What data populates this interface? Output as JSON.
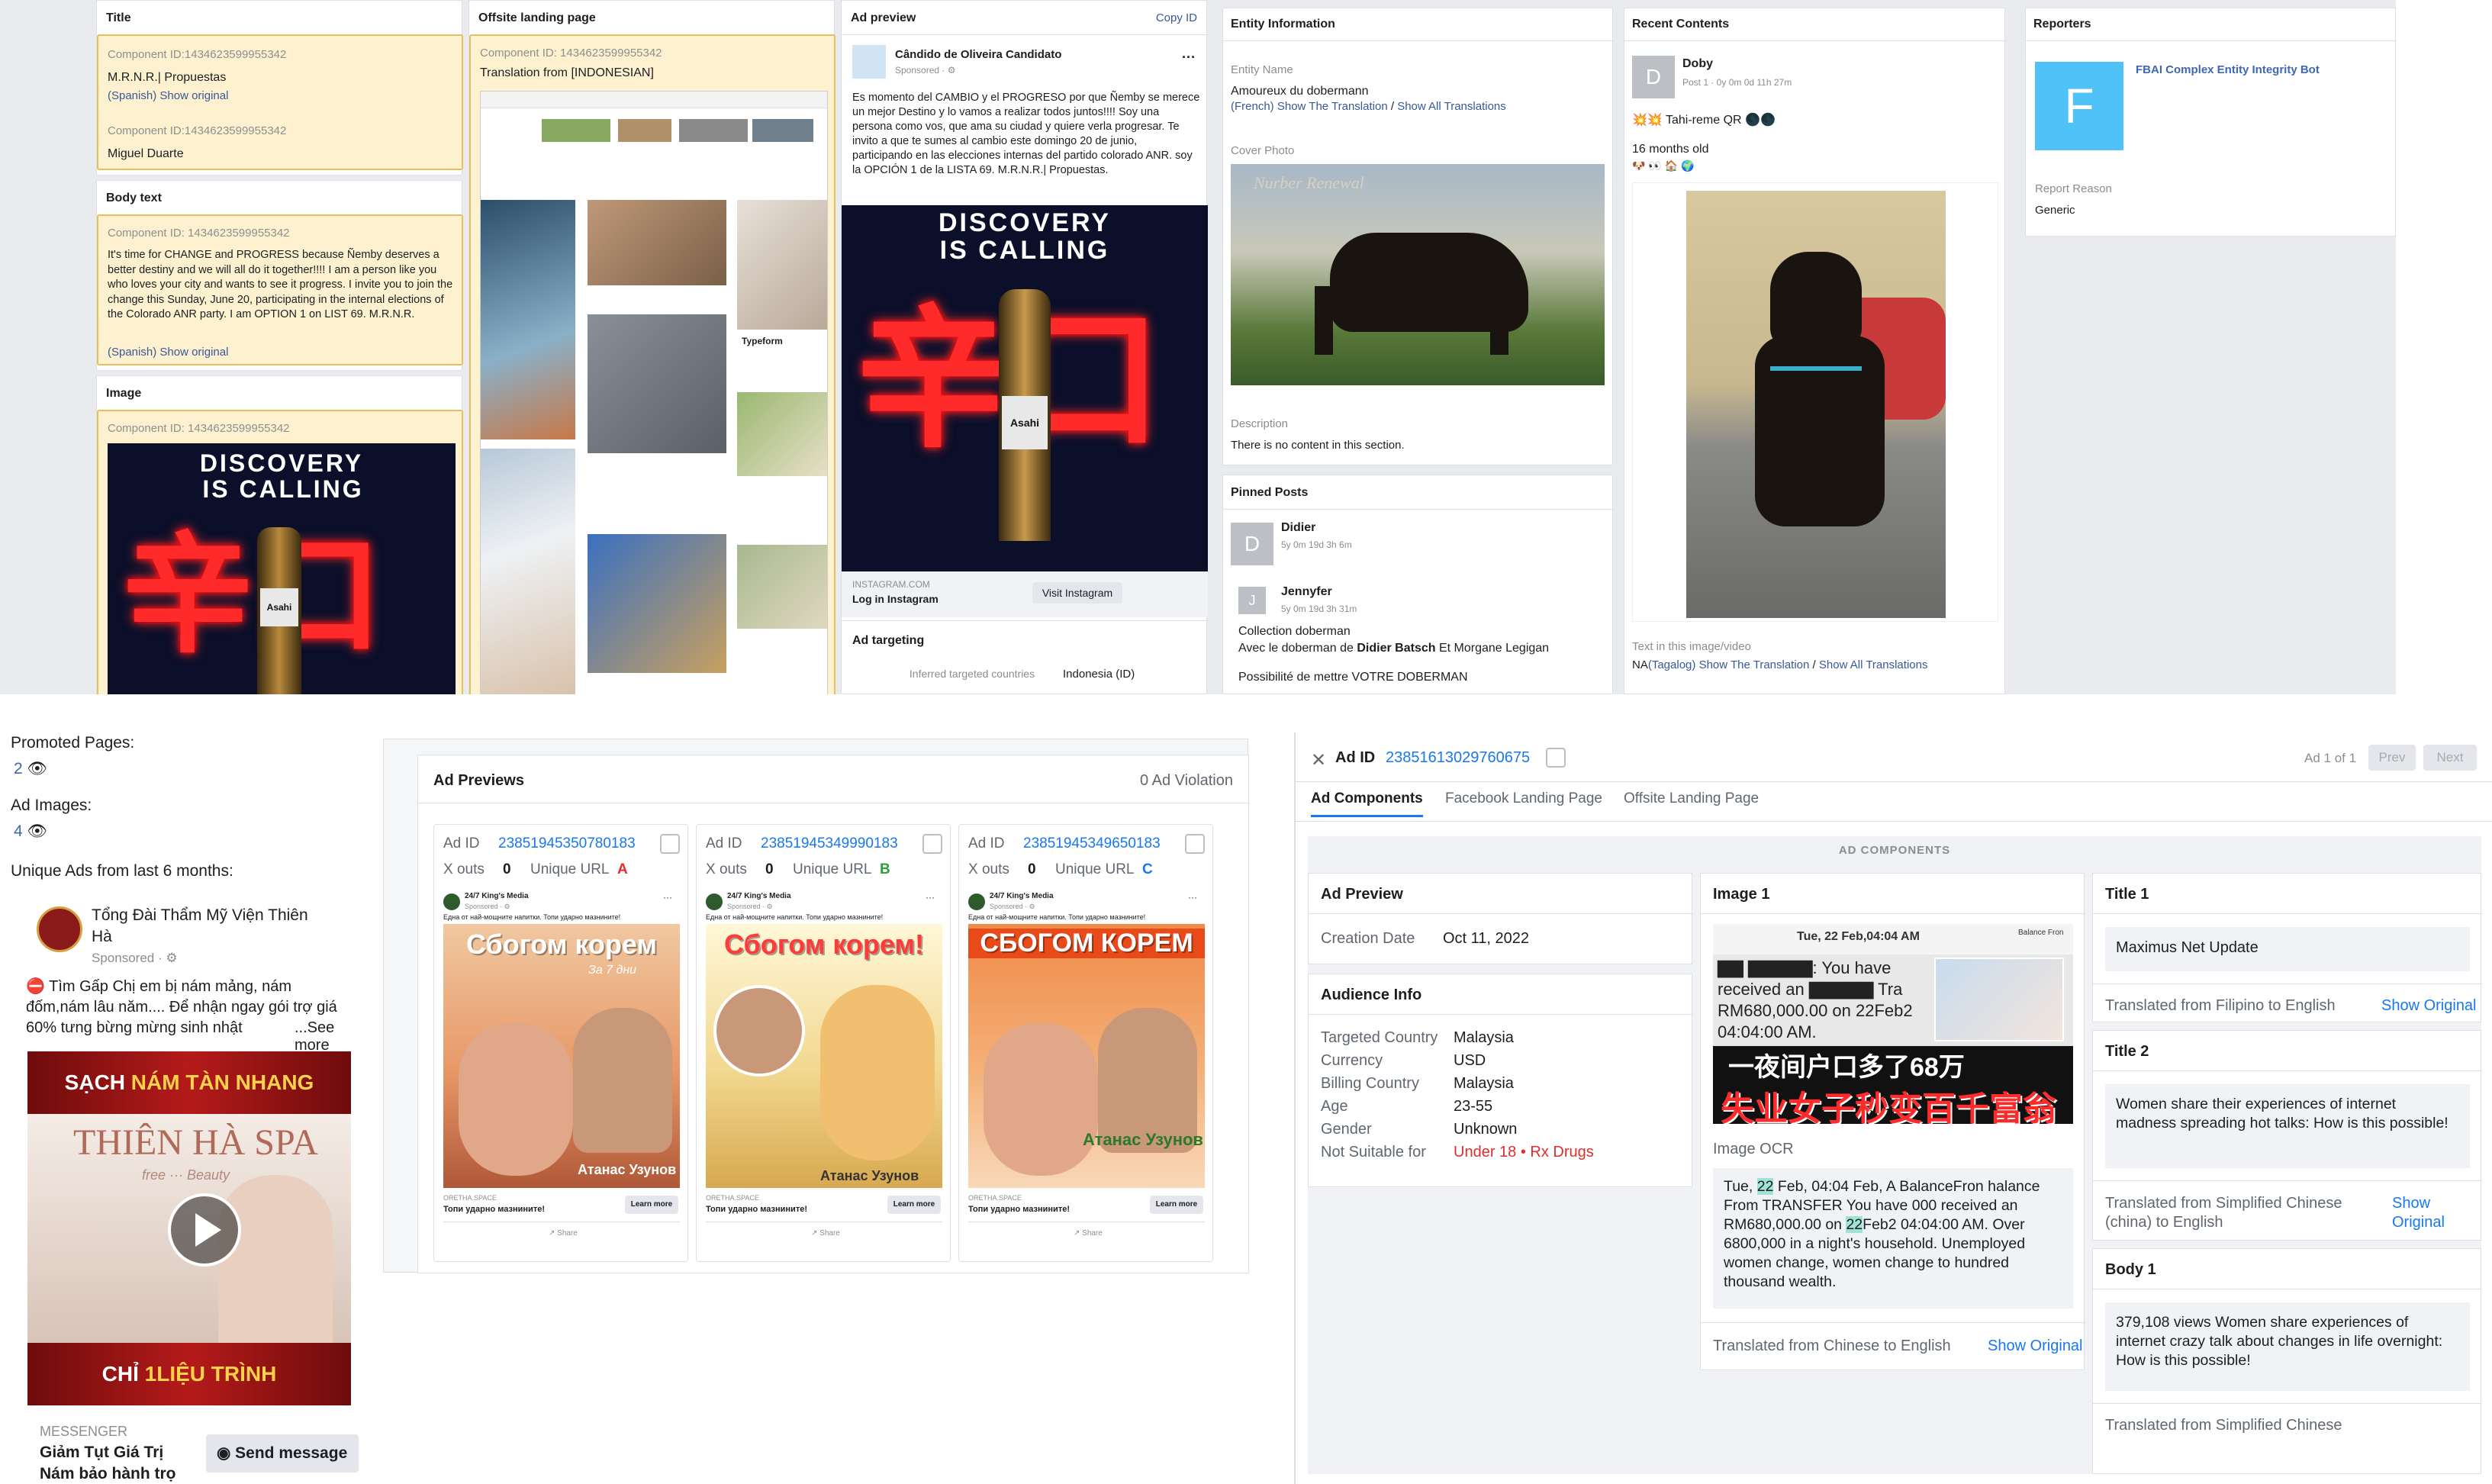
{
  "q1": {
    "title_label": "Title",
    "comp_id_1": "Component ID:1434623599955342",
    "title_value": "M.R.N.R.| Propuestas",
    "spanish_1": "(Spanish)",
    "show_original": "Show original",
    "comp_id_2": "Component ID:1434623599955342",
    "name_value": "Miguel Duarte",
    "body_label": "Body text",
    "comp_id_3": "Component ID: 1434623599955342",
    "body_value": "It's time for CHANGE and PROGRESS because Ñemby deserves a better destiny and we will all do it together!!!! I am a person like you who loves your city and wants to see it progress. I invite you to join the change this Sunday, June 20, participating in the internal elections of the Colorado ANR party. I am OPTION 1 on LIST 69. M.R.N.R.",
    "spanish_2": "(Spanish)",
    "image_label": "Image",
    "comp_id_4": "Component ID: 1434623599955342",
    "poster_text_1": "DISCOVERY",
    "poster_text_2": "IS CALLING",
    "neon_chars": "辛口",
    "landing_label": "Offsite landing page",
    "comp_id_5": "Component ID: 1434623599955342",
    "translation_from": "Translation from [INDONESIAN]",
    "typeform_label": "Typeform",
    "ad_preview_label": "Ad preview",
    "copy_id": "Copy ID",
    "advertiser": "Cândido de Oliveira Candidato",
    "sponsored": "Sponsored · ⚙",
    "ad_text": "Es momento del CAMBIO y el PROGRESO por que Ñemby se merece un mejor Destino y lo vamos a realizar todos juntos!!!! Soy una persona como vos, que ama su ciudad y quiere verla progresar. Te invito a que te sumes al cambio este domingo 20 de junio, participando en las elecciones internas del partido colorado ANR. soy la OPCIÓN 1 de la LISTA 69. M.R.N.R.| Propuestas.",
    "beer_brand": "Asahi",
    "insta_domain": "INSTAGRAM.COM",
    "insta_login": "Log in Instagram",
    "visit_instagram": "Visit Instagram",
    "ad_targeting": "Ad targeting",
    "inferred_targeted": "Inferred targeted countries",
    "targeted_country": "Indonesia (ID)",
    "entity_info": "Entity Information",
    "entity_name_label": "Entity Name",
    "entity_name": "Amoureux du dobermann",
    "french": "(French)",
    "show_translation": "Show The Translation",
    "slash": "/",
    "show_all_translations": "Show All Translations",
    "cover_photo": "Cover Photo",
    "cover_caption": "Nurber Renewal",
    "description_label": "Description",
    "description_value": "There is no content in this section.",
    "pinned_posts": "Pinned Posts",
    "didier": "Didier",
    "didier_time": "5y 0m 19d 3h 6m",
    "jennyfer": "Jennyfer",
    "jennyfer_time": "5y 0m 19d 3h 31m",
    "collection": "Collection doberman",
    "avec_prefix": "Avec le doberman de",
    "didier_batsch": "Didier Batsch",
    "avec_suffix": "Et Morgane Legigan",
    "possibilite": "Possibilité de mettre VOTRE DOBERMAN",
    "recent_contents": "Recent Contents",
    "doby": "Doby",
    "doby_meta": "Post 1 · 0y 0m 0d 11h 27m",
    "tahi_line": "💥💥 Tahi-reme QR 🌑🌑",
    "months_old": "16 months old",
    "emoji_line": "🐶 👀 🏠 🌍",
    "text_in_image": "Text in this image/video",
    "na": "NA",
    "tagalog": "(Tagalog)",
    "reporters": "Reporters",
    "reporter_initial": "F",
    "reporter_name": "FBAI Complex Entity Integrity Bot",
    "report_reason_label": "Report Reason",
    "report_reason": "Generic"
  },
  "q3": {
    "promoted_pages": "Promoted Pages:",
    "promoted_count": "2",
    "ad_images": "Ad Images:",
    "ad_images_count": "4",
    "unique_ads": "Unique Ads from last 6 months:",
    "page_name": "Tổng Đài Thẩm Mỹ Viện Thiên Hà",
    "sponsored": "Sponsored · ⚙",
    "ad_text": "⛔ Tìm Gấp Chị em bị nám mảng, nám đốm,nám lâu năm.... Để nhận ngay gói trợ giá 60% tưng bừng mừng sinh nhật",
    "see_more": "...See more",
    "banner_1_a": "SẠCH",
    "banner_1_b": "NÁM TÀN NHANG",
    "spa_name": "THIÊN HÀ SPA",
    "spa_sub": "free ··· Beauty",
    "banner_2_a": "CHỈ",
    "banner_2_b": "1LIỆU TRÌNH",
    "messenger": "MESSENGER",
    "cta_line_1": "Giảm Tụt Giá Trị",
    "cta_line_2": "Nám bảo hành trọ",
    "send_message": "Send message"
  },
  "q4": {
    "title": "Ad Previews",
    "violation": "0 Ad Violation",
    "cards": [
      {
        "ad_id_label": "Ad ID",
        "ad_id": "23851945350780183",
        "x_outs_label": "X outs",
        "x_outs": "0",
        "unique_url_label": "Unique URL",
        "unique_url": "A",
        "page": "24/7 King's Media",
        "sponsored": "Sponsored · ⚙",
        "caption": "Една от най-мощните напитки. Топи ударно мазнините!",
        "banner": "Сбогом корем",
        "sub": "За 7 дни",
        "person": "Атанас Узунов",
        "domain": "ORETHA.SPACE",
        "headline": "Топи ударно мазнините!",
        "learn_more": "Learn more",
        "share": "Share"
      },
      {
        "ad_id_label": "Ad ID",
        "ad_id": "23851945349990183",
        "x_outs_label": "X outs",
        "x_outs": "0",
        "unique_url_label": "Unique URL",
        "unique_url": "B",
        "page": "24/7 King's Media",
        "sponsored": "Sponsored · ⚙",
        "caption": "Една от най-мощните напитки. Топи ударно мазнините!",
        "banner": "Сбогом корем!",
        "sub": "",
        "person": "Атанас Узунов",
        "domain": "ORETHA.SPACE",
        "headline": "Топи ударно мазнините!",
        "learn_more": "Learn more",
        "share": "Share"
      },
      {
        "ad_id_label": "Ad ID",
        "ad_id": "23851945349650183",
        "x_outs_label": "X outs",
        "x_outs": "0",
        "unique_url_label": "Unique URL",
        "unique_url": "C",
        "page": "24/7 King's Media",
        "sponsored": "Sponsored · ⚙",
        "caption": "Една от най-мощните напитки. Топи ударно мазнините!",
        "banner": "СБОГОМ КОРЕМ",
        "sub": "",
        "person": "Атанас Узунов",
        "domain": "ORETHA.SPACE",
        "headline": "Топи ударно мазнините!",
        "learn_more": "Learn more",
        "share": "Share"
      }
    ]
  },
  "q5": {
    "ad_id_label": "Ad ID",
    "ad_id": "23851613029760675",
    "pager": "Ad 1 of 1",
    "prev": "Prev",
    "next": "Next",
    "tabs": [
      "Ad Components",
      "Facebook Landing Page",
      "Offsite Landing Page"
    ],
    "section_header": "AD COMPONENTS",
    "ad_preview": "Ad Preview",
    "creation_date_label": "Creation Date",
    "creation_date": "Oct 11, 2022",
    "audience_info": "Audience Info",
    "targeted_country_label": "Targeted Country",
    "targeted_country": "Malaysia",
    "currency_label": "Currency",
    "currency": "USD",
    "billing_country_label": "Billing Country",
    "billing_country": "Malaysia",
    "age_label": "Age",
    "age": "23-55",
    "gender_label": "Gender",
    "gender": "Unknown",
    "not_suitable_label": "Not Suitable for",
    "not_suitable": "Under 18 • Rx Drugs",
    "image1": "Image 1",
    "img_date": "Tue, 22 Feb,04:04 AM",
    "img_corner": "Balance Fron",
    "img_line1": "▇▇ ▇▇▇▇▇: You have",
    "img_line2": "received an ▇▇▇▇▇ Tra",
    "img_line3": "RM680,000.00 on 22Feb2",
    "img_line4": "04:04:00 AM.",
    "img_cn1": "一夜间户口多了68万",
    "img_cn2": "失业女子秒变百千富翁",
    "image_ocr": "Image OCR",
    "ocr_a": "Tue,",
    "ocr_hl1": "22",
    "ocr_b": "Feb, 04:04 Feb, A BalanceFron halance From TRANSFER You have 000 received an RM680,000.00 on",
    "ocr_hl2": "22",
    "ocr_c": "Feb2 04:04:00 AM. Over 6800,000 in a night's household. Unemployed women change, women change to hundred thousand wealth.",
    "translated_cn": "Translated from Chinese to English",
    "show_original": "Show Original",
    "title1": "Title 1",
    "title1_value": "Maximus Net Update",
    "translated_fil": "Translated from Filipino to English",
    "title2": "Title 2",
    "title2_value": "Women share their experiences of internet madness spreading hot talks: How is this possible!",
    "translated_zh": "Translated from Simplified Chinese (china) to English",
    "body1": "Body 1",
    "body1_value": "379,108 views Women share experiences of internet crazy talk about changes in life overnight: How is this possible!",
    "translated_zh2": "Translated from Simplified Chinese"
  }
}
